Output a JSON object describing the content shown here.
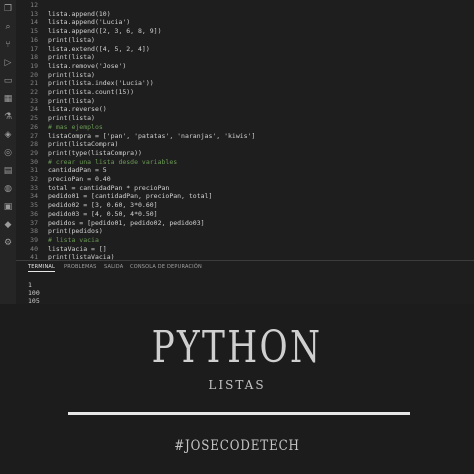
{
  "editor": {
    "line_numbers": [
      "12",
      "13",
      "14",
      "15",
      "16",
      "17",
      "18",
      "19",
      "20",
      "21",
      "22",
      "23",
      "24",
      "25",
      "26",
      "27",
      "28",
      "29",
      "30",
      "31",
      "32",
      "33",
      "34",
      "35",
      "36",
      "37",
      "38",
      "39",
      "40",
      "41"
    ],
    "lines": [
      {
        "text": ""
      },
      {
        "text": "lista.append(10)"
      },
      {
        "text": "lista.append('Lucia')"
      },
      {
        "text": "lista.append([2, 3, 6, 8, 9])"
      },
      {
        "text": "print(lista)"
      },
      {
        "text": "lista.extend([4, 5, 2, 4])"
      },
      {
        "text": "print(lista)"
      },
      {
        "text": "lista.remove('Jose')"
      },
      {
        "text": "print(lista)"
      },
      {
        "text": "print(lista.index('Lucia'))"
      },
      {
        "text": "print(lista.count(15))"
      },
      {
        "text": "print(lista)"
      },
      {
        "text": "lista.reverse()"
      },
      {
        "text": "print(lista)"
      },
      {
        "text": "# mas ejemplos",
        "comment": true
      },
      {
        "text": "listaCompra = ['pan', 'patatas', 'naranjas', 'kiwis']"
      },
      {
        "text": "print(listaCompra)"
      },
      {
        "text": "print(type(listaCompra))"
      },
      {
        "text": "# crear una lista desde variables",
        "comment": true
      },
      {
        "text": "cantidadPan = 5"
      },
      {
        "text": "precioPan = 0.40"
      },
      {
        "text": "total = cantidadPan * precioPan"
      },
      {
        "text": "pedido01 = [cantidadPan, precioPan, total]"
      },
      {
        "text": "pedido02 = [3, 0.60, 3*0.60]"
      },
      {
        "text": "pedido03 = [4, 0.50, 4*0.50]"
      },
      {
        "text": "pedidos = [pedido01, pedido02, pedido03]"
      },
      {
        "text": "print(pedidos)"
      },
      {
        "text": "# lista vacia",
        "comment": true
      },
      {
        "text": "listaVacia = []"
      },
      {
        "text": "print(listaVacia)"
      }
    ]
  },
  "panel": {
    "tabs": [
      "TERMINAL",
      "PROBLEMAS",
      "SALIDA",
      "CONSOLA DE DEPURACIÓN"
    ],
    "output": [
      "1",
      "100",
      "105"
    ]
  },
  "activity_icons": [
    "files-icon",
    "search-icon",
    "source-control-icon",
    "run-debug-icon",
    "remote-icon",
    "extensions-icon",
    "testing-icon",
    "git-icon",
    "docker-icon",
    "folder-icon",
    "database-icon",
    "terminal-icon",
    "python-icon",
    "settings-icon"
  ],
  "overlay": {
    "title": "PYTHON",
    "subtitle": "LISTAS",
    "hashtag": "#JOSECODETECH"
  }
}
